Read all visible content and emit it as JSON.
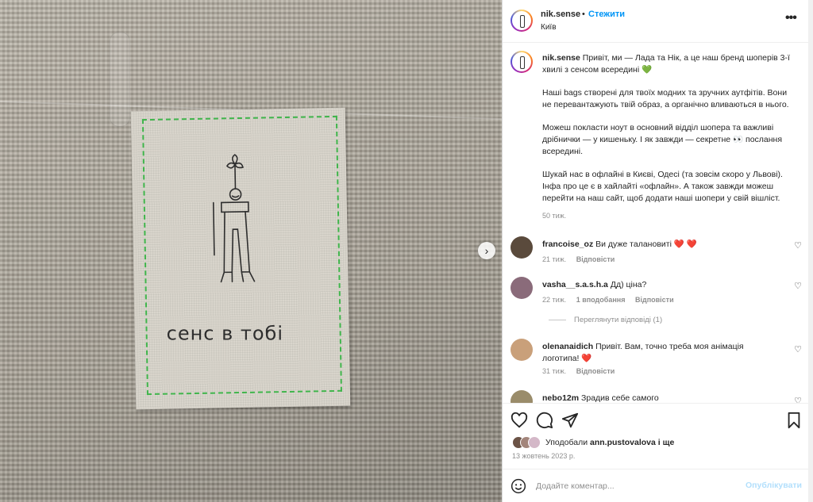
{
  "header": {
    "username": "nik.sense",
    "separator": "•",
    "follow_label": "Стежити",
    "location": "Київ",
    "more_icon": "more-horizontal-icon"
  },
  "media": {
    "label_text": "сенс в тобі",
    "next_icon": "chevron-right-icon"
  },
  "caption": {
    "username": "nik.sense",
    "p1": "Привіт, ми — Лада та Нік, а це наш бренд шоперів 3-ї хвилі з сенсом всередині 💚",
    "p2": "Наші bags створені для твоїх модних та зручних аутфітів. Вони не перевантажують твій образ, а органічно вливаються в нього.",
    "p3": "Можеш покласти ноут в основний відділ шопера та важливі дрібнички — у кишеньку. І як завжди — секретне 👀 послання всередині.",
    "p4": "Шукай нас в офлайні в Києві, Одесі (та зовсім скоро у Львові). Інфа про це є в хайлайті «офлайн». А також завжди можеш перейти на наш сайт, щоб додати наші шопери у свій вішліст.",
    "time": "50 тиж."
  },
  "comments": [
    {
      "username": "francoise_oz",
      "text": "Ви дуже талановиті",
      "hearts": "❤️ ❤️",
      "time": "21 тиж.",
      "reply_label": "Відповісти",
      "avatar_color": "#5a4a3c"
    },
    {
      "username": "vasha__s.a.s.h.a",
      "text": "Дд) ціна?",
      "time": "22 тиж.",
      "likes": "1 вподобання",
      "reply_label": "Відповісти",
      "avatar_color": "#8a6b7a"
    },
    {
      "username": "olenanaidich",
      "text": "Привіт. Вам, точно треба моя анімація логотипа!",
      "hearts": "❤️",
      "time": "31 тиж.",
      "reply_label": "Відповісти",
      "avatar_color": "#c9a07a"
    },
    {
      "username": "nebo12m",
      "text": "Зрадив себе самого",
      "avatar_color": "#9a8c6a"
    }
  ],
  "view_replies": "Переглянути відповіді (1)",
  "actions": {
    "like_icon": "heart-icon",
    "comment_icon": "comment-icon",
    "share_icon": "send-icon",
    "save_icon": "bookmark-icon"
  },
  "likes": {
    "prefix": "Уподобали",
    "user": "ann.pustovalova",
    "suffix": "і ще"
  },
  "post_date": "13 жовтень 2023 р.",
  "composer": {
    "placeholder": "Додайте коментар...",
    "publish_label": "Опублікувати",
    "emoji_icon": "emoji-icon"
  },
  "colors": {
    "link": "#0095f6",
    "muted": "#8e8e8e",
    "heart": "#ed4956",
    "stitch": "#3fb54b"
  }
}
